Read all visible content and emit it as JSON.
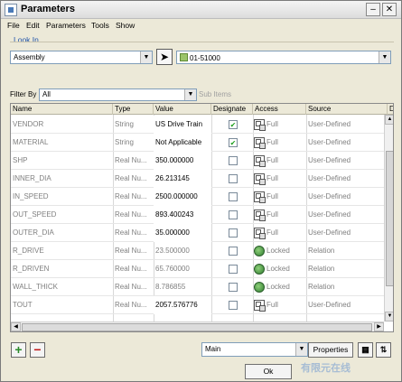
{
  "window": {
    "title": "Parameters"
  },
  "menu": [
    "File",
    "Edit",
    "Parameters",
    "Tools",
    "Show"
  ],
  "look_in": {
    "label": "Look In",
    "type_value": "Assembly",
    "owner_value": "01-51000"
  },
  "filter": {
    "label": "Filter By",
    "value": "All",
    "sub_items_label": "Sub Items"
  },
  "columns": [
    "Name",
    "Type",
    "Value",
    "Designate",
    "Access",
    "Source",
    "D"
  ],
  "rows": [
    {
      "name": "VENDOR",
      "type": "String",
      "value": "US Drive Train",
      "designate": true,
      "access": "Full",
      "access_icon": "full-access-icon",
      "source": "User-Defined",
      "editable": true
    },
    {
      "name": "MATERIAL",
      "type": "String",
      "value": "Not Applicable",
      "designate": true,
      "access": "Full",
      "access_icon": "full-access-icon",
      "source": "User-Defined",
      "editable": true
    },
    {
      "name": "SHP",
      "type": "Real Nu...",
      "value": "350.000000",
      "designate": false,
      "access": "Full",
      "access_icon": "full-access-icon",
      "source": "User-Defined",
      "editable": true
    },
    {
      "name": "INNER_DIA",
      "type": "Real Nu...",
      "value": "26.213145",
      "designate": false,
      "access": "Full",
      "access_icon": "full-access-icon",
      "source": "User-Defined",
      "editable": true
    },
    {
      "name": "IN_SPEED",
      "type": "Real Nu...",
      "value": "2500.000000",
      "designate": false,
      "access": "Full",
      "access_icon": "full-access-icon",
      "source": "User-Defined",
      "editable": true
    },
    {
      "name": "OUT_SPEED",
      "type": "Real Nu...",
      "value": "893.400243",
      "designate": false,
      "access": "Full",
      "access_icon": "full-access-icon",
      "source": "User-Defined",
      "editable": true
    },
    {
      "name": "OUTER_DIA",
      "type": "Real Nu...",
      "value": "35.000000",
      "designate": false,
      "access": "Full",
      "access_icon": "full-access-icon",
      "source": "User-Defined",
      "editable": true
    },
    {
      "name": "R_DRIVE",
      "type": "Real Nu...",
      "value": "23.500000",
      "designate": false,
      "access": "Locked",
      "access_icon": "locked-access-icon",
      "source": "Relation",
      "editable": false
    },
    {
      "name": "R_DRIVEN",
      "type": "Real Nu...",
      "value": "65.760000",
      "designate": false,
      "access": "Locked",
      "access_icon": "locked-access-icon",
      "source": "Relation",
      "editable": false
    },
    {
      "name": "WALL_THICK",
      "type": "Real Nu...",
      "value": "8.786855",
      "designate": false,
      "access": "Locked",
      "access_icon": "locked-access-icon",
      "source": "Relation",
      "editable": false
    },
    {
      "name": "TOUT",
      "type": "Real Nu...",
      "value": "2057.576776",
      "designate": false,
      "access": "Full",
      "access_icon": "full-access-icon",
      "source": "User-Defined",
      "editable": true
    }
  ],
  "bottom": {
    "add_label": "+",
    "remove_label": "−",
    "view_value": "Main",
    "properties_label": "Properties",
    "ok_label": "Ok"
  },
  "colors": {
    "add": "#2a8a2a",
    "remove": "#c01818",
    "check": "#21a121",
    "accent_label": "#2255aa"
  },
  "watermark": "有限元在线"
}
